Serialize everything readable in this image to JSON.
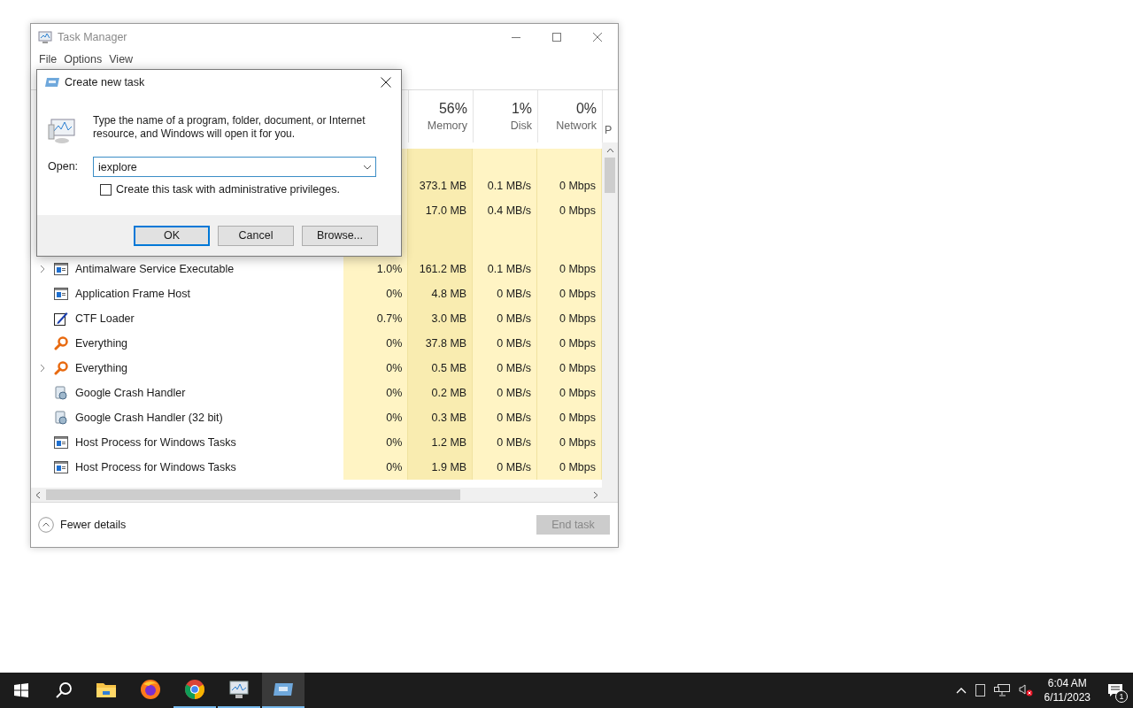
{
  "task_manager": {
    "title": "Task Manager",
    "menu": [
      "File",
      "Options",
      "View"
    ],
    "columns": [
      {
        "percent": "56%",
        "label": "Memory"
      },
      {
        "percent": "1%",
        "label": "Disk"
      },
      {
        "percent": "0%",
        "label": "Network"
      }
    ],
    "cut_column": "P",
    "rows": [
      {
        "kind": "group"
      },
      {
        "kind": "covered",
        "memory": "373.1 MB",
        "disk": "0.1 MB/s",
        "network": "0 Mbps"
      },
      {
        "kind": "covered",
        "memory": "17.0 MB",
        "disk": "0.4 MB/s",
        "network": "0 Mbps"
      },
      {
        "kind": "group"
      },
      {
        "kind": "window",
        "name": "Antimalware Service Executable",
        "expandable": true,
        "cpu": "1.0%",
        "memory": "161.2 MB",
        "disk": "0.1 MB/s",
        "network": "0 Mbps"
      },
      {
        "kind": "window",
        "name": "Application Frame Host",
        "expandable": false,
        "cpu": "0%",
        "memory": "4.8 MB",
        "disk": "0 MB/s",
        "network": "0 Mbps"
      },
      {
        "kind": "pen",
        "name": "CTF Loader",
        "expandable": false,
        "cpu": "0.7%",
        "memory": "3.0 MB",
        "disk": "0 MB/s",
        "network": "0 Mbps"
      },
      {
        "kind": "magnifier",
        "name": "Everything",
        "expandable": false,
        "cpu": "0%",
        "memory": "37.8 MB",
        "disk": "0 MB/s",
        "network": "0 Mbps"
      },
      {
        "kind": "magnifier",
        "name": "Everything",
        "expandable": true,
        "cpu": "0%",
        "memory": "0.5 MB",
        "disk": "0 MB/s",
        "network": "0 Mbps"
      },
      {
        "kind": "crash",
        "name": "Google Crash Handler",
        "expandable": false,
        "cpu": "0%",
        "memory": "0.2 MB",
        "disk": "0 MB/s",
        "network": "0 Mbps"
      },
      {
        "kind": "crash",
        "name": "Google Crash Handler (32 bit)",
        "expandable": false,
        "cpu": "0%",
        "memory": "0.3 MB",
        "disk": "0 MB/s",
        "network": "0 Mbps"
      },
      {
        "kind": "window",
        "name": "Host Process for Windows Tasks",
        "expandable": false,
        "cpu": "0%",
        "memory": "1.2 MB",
        "disk": "0 MB/s",
        "network": "0 Mbps"
      },
      {
        "kind": "window",
        "name": "Host Process for Windows Tasks",
        "expandable": false,
        "cpu": "0%",
        "memory": "1.9 MB",
        "disk": "0 MB/s",
        "network": "0 Mbps"
      }
    ],
    "fewer_details": "Fewer details",
    "end_task": {
      "label": "End task",
      "disabled": true
    }
  },
  "dialog": {
    "title": "Create new task",
    "message": "Type the name of a program, folder, document, or Internet resource, and Windows will open it for you.",
    "open_label": "Open:",
    "open_value": "iexplore",
    "admin": {
      "label": "Create this task with administrative privileges.",
      "checked": false
    },
    "buttons": [
      {
        "label": "OK",
        "default": true
      },
      {
        "label": "Cancel",
        "default": false
      },
      {
        "label": "Browse...",
        "default": false
      }
    ]
  },
  "taskbar": {
    "apps": [
      {
        "kind": "explorer",
        "running": false,
        "selected": false
      },
      {
        "kind": "firefox",
        "running": false,
        "selected": false
      },
      {
        "kind": "chrome",
        "running": true,
        "selected": false
      },
      {
        "kind": "taskmgr",
        "running": true,
        "selected": false
      },
      {
        "kind": "run",
        "running": true,
        "selected": true
      }
    ],
    "time": "6:04 AM",
    "date": "6/11/2023",
    "notifications": "1"
  }
}
